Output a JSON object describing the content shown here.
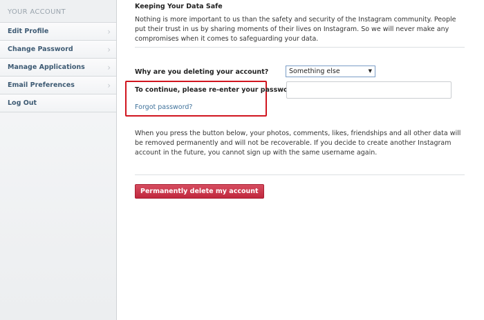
{
  "sidebar": {
    "heading": "YOUR ACCOUNT",
    "items": [
      {
        "label": "Edit Profile",
        "chevron": "›"
      },
      {
        "label": "Change Password",
        "chevron": "›"
      },
      {
        "label": "Manage Applications",
        "chevron": "›"
      },
      {
        "label": "Email Preferences",
        "chevron": "›"
      },
      {
        "label": "Log Out"
      }
    ]
  },
  "main": {
    "section_title": "Keeping Your Data Safe",
    "intro": "Nothing is more important to us than the safety and security of the Instagram community. People put their trust in us by sharing moments of their lives on Instagram. So we will never make any compromises when it comes to safeguarding your data.",
    "reason": {
      "label": "Why are you deleting your account?",
      "selected": "Something else",
      "arrow": "▼"
    },
    "password": {
      "label": "To continue, please re-enter your password",
      "value": "",
      "forgot_link": "Forgot password?"
    },
    "warning": "When you press the button below, your photos, comments, likes, friendships and all other data will be removed permanently and will not be recoverable. If you decide to create another Instagram account in the future, you cannot sign up with the same username again.",
    "delete_button": "Permanently delete my account",
    "colors": {
      "highlight_border": "#d0141e",
      "delete_button": "#c0273d",
      "link": "#3f729b",
      "sidebar_text": "#3d5a73"
    }
  }
}
